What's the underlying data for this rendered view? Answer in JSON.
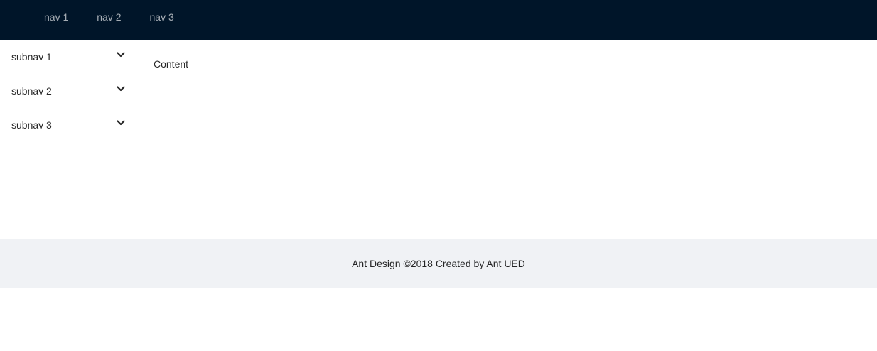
{
  "header": {
    "nav": [
      {
        "label": "nav 1"
      },
      {
        "label": "nav 2"
      },
      {
        "label": "nav 3"
      }
    ]
  },
  "sider": {
    "submenus": [
      {
        "label": "subnav 1",
        "icon": "chevron-down-icon"
      },
      {
        "label": "subnav 2",
        "icon": "chevron-down-icon"
      },
      {
        "label": "subnav 3",
        "icon": "chevron-down-icon"
      }
    ]
  },
  "content": {
    "text": "Content"
  },
  "footer": {
    "text": "Ant Design ©2018 Created by Ant UED"
  },
  "colors": {
    "header_bg": "#001529",
    "footer_bg": "#f0f2f5",
    "nav_text": "#a6adb4"
  }
}
